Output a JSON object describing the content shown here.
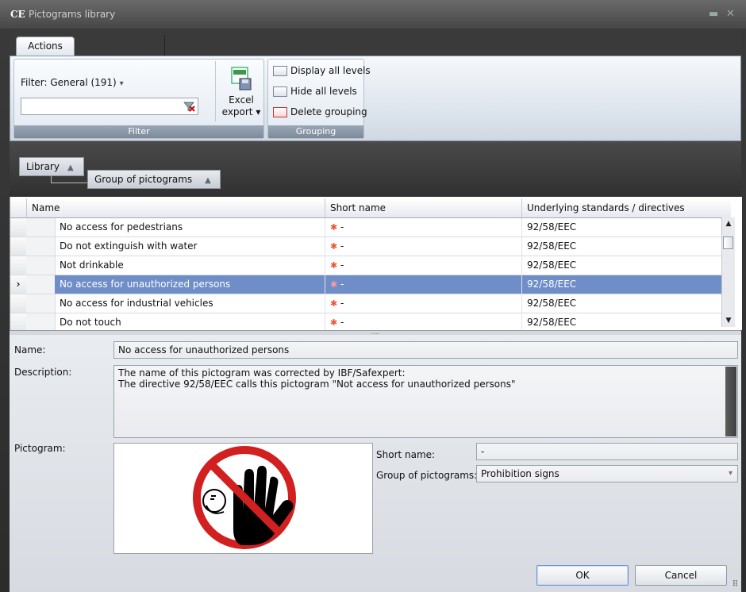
{
  "window": {
    "logo": "CE",
    "title": "Pictograms library",
    "minimize_icon": "▬",
    "close_icon": "✕"
  },
  "ribbon": {
    "tab_label": "Actions",
    "filter": {
      "label": "Filter: General (191)",
      "dropdown_arrow": "▾",
      "search_value": "",
      "caption": "Filter"
    },
    "excel": {
      "label_line1": "Excel",
      "label_line2": "export ▾"
    },
    "grouping": {
      "display_all": "Display all levels",
      "hide_all": "Hide all levels",
      "delete_grouping": "Delete grouping",
      "caption": "Grouping"
    }
  },
  "group_panel": {
    "level1": "Library",
    "level2": "Group of pictograms",
    "sort_arrow": "▲"
  },
  "grid": {
    "columns": [
      "Name",
      "Short name",
      "Underlying standards / directives"
    ],
    "rows": [
      {
        "name": "No access for pedestrians",
        "short": "-",
        "std": "92/58/EEC",
        "selected": false
      },
      {
        "name": "Do not extinguish with water",
        "short": "-",
        "std": "92/58/EEC",
        "selected": false
      },
      {
        "name": "Not drinkable",
        "short": "-",
        "std": "92/58/EEC",
        "selected": false
      },
      {
        "name": "No access for unauthorized persons",
        "short": "-",
        "std": "92/58/EEC",
        "selected": true
      },
      {
        "name": "No access for industrial vehicles",
        "short": "-",
        "std": "92/58/EEC",
        "selected": false
      },
      {
        "name": "Do not touch",
        "short": "-",
        "std": "92/58/EEC",
        "selected": false
      }
    ],
    "star": "✱",
    "current_row_marker": "›"
  },
  "detail": {
    "name_label": "Name:",
    "name_value": "No access for unauthorized persons",
    "desc_label": "Description:",
    "desc_line1": "The name of this pictogram was corrected by IBF/Safexpert:",
    "desc_line2": "The directive 92/58/EEC calls this pictogram \"Not access for unauthorized persons\"",
    "pictogram_label": "Pictogram:",
    "short_label": "Short name:",
    "short_value": "-",
    "group_label": "Group of pictograms:",
    "group_value": "Prohibition signs",
    "group_arrow": "▾"
  },
  "buttons": {
    "ok": "OK",
    "cancel": "Cancel"
  },
  "colors": {
    "selection": "#6f8dc7",
    "prohibition_red": "#d21f1f"
  }
}
